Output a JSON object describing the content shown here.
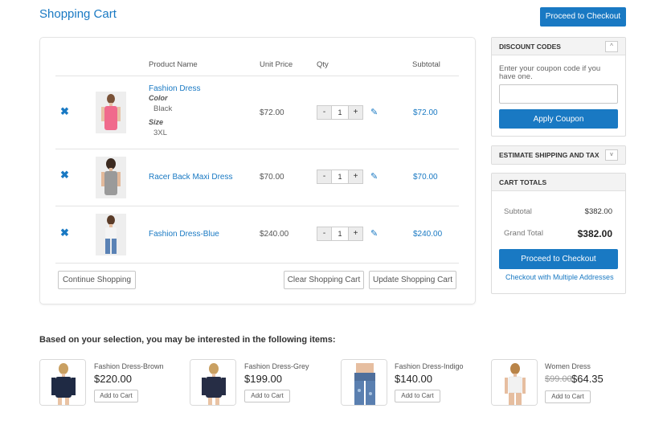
{
  "page": {
    "title": "Shopping Cart",
    "proceed_top": "Proceed to Checkout"
  },
  "cart": {
    "headers": {
      "product": "Product Name",
      "unit_price": "Unit Price",
      "qty": "Qty",
      "subtotal": "Subtotal"
    },
    "remove_icon": "x-icon",
    "edit_icon": "pencil-icon",
    "items": [
      {
        "name": "Fashion Dress",
        "color_label": "Color",
        "color": "Black",
        "size_label": "Size",
        "size": "3XL",
        "price": "$72.00",
        "qty": "1",
        "subtotal": "$72.00",
        "minus": "-",
        "plus": "+"
      },
      {
        "name": "Racer Back Maxi Dress",
        "price": "$70.00",
        "qty": "1",
        "subtotal": "$70.00",
        "minus": "-",
        "plus": "+"
      },
      {
        "name": "Fashion Dress-Blue",
        "price": "$240.00",
        "qty": "1",
        "subtotal": "$240.00",
        "minus": "-",
        "plus": "+"
      }
    ],
    "actions": {
      "continue": "Continue Shopping",
      "clear": "Clear Shopping Cart",
      "update": "Update Shopping Cart"
    }
  },
  "sidebar": {
    "discount": {
      "title": "DISCOUNT CODES",
      "toggle": "^",
      "text": "Enter your coupon code if you have one.",
      "input_value": "",
      "apply": "Apply Coupon"
    },
    "shipping": {
      "title": "ESTIMATE SHIPPING AND TAX",
      "toggle": "v"
    },
    "totals": {
      "title": "CART TOTALS",
      "subtotal_label": "Subtotal",
      "subtotal": "$382.00",
      "grand_label": "Grand Total",
      "grand": "$382.00",
      "checkout": "Proceed to Checkout",
      "multi": "Checkout with Multiple Addresses"
    }
  },
  "recommendations": {
    "title": "Based on your selection, you may be interested in the following items:",
    "add_label": "Add to Cart",
    "items": [
      {
        "name": "Fashion Dress-Brown",
        "price": "$220.00"
      },
      {
        "name": "Fashion Dress-Grey",
        "price": "$199.00"
      },
      {
        "name": "Fashion Dress-Indigo",
        "price": "$140.00"
      },
      {
        "name": "Women Dress",
        "old_price": "$99.00",
        "price": "$64.35"
      }
    ]
  },
  "colors": {
    "accent": "#1979c3",
    "border": "#e4e4e4"
  }
}
